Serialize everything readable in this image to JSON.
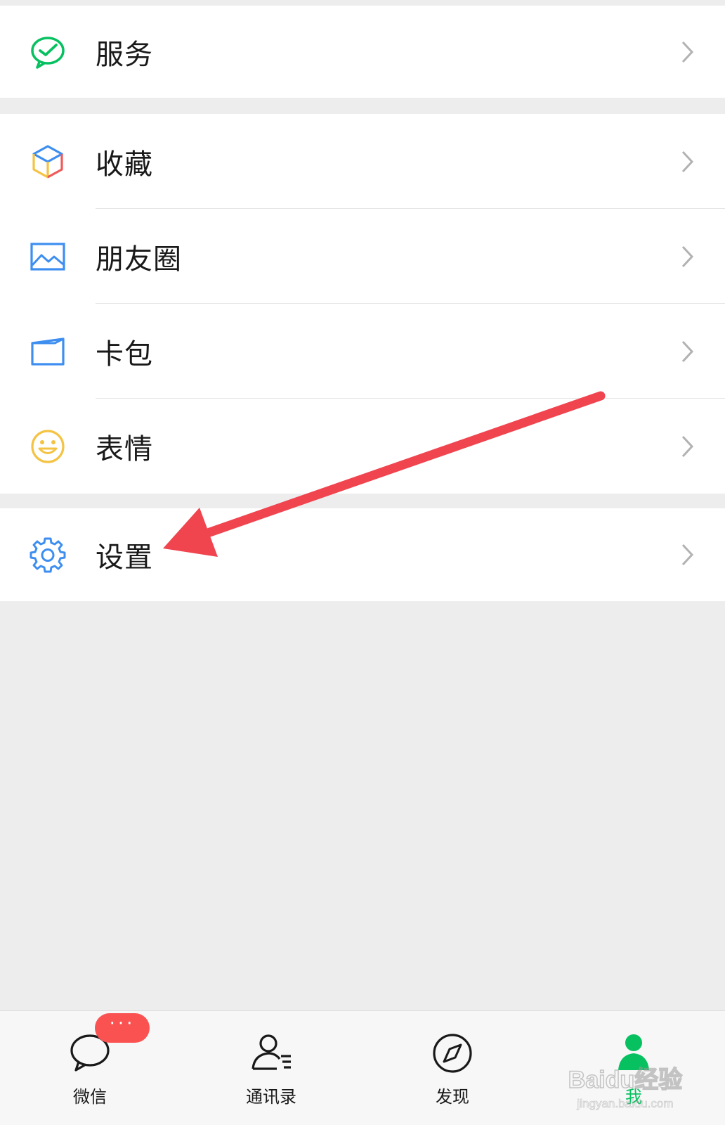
{
  "menu": {
    "service": {
      "label": "服务",
      "icon": "wechat-pay-icon"
    },
    "favorites": {
      "label": "收藏",
      "icon": "cube-icon"
    },
    "moments": {
      "label": "朋友圈",
      "icon": "picture-icon"
    },
    "cards": {
      "label": "卡包",
      "icon": "card-icon"
    },
    "stickers": {
      "label": "表情",
      "icon": "smile-icon"
    },
    "settings": {
      "label": "设置",
      "icon": "gear-icon"
    }
  },
  "tabbar": {
    "chats": {
      "label": "微信",
      "icon": "chat-bubble-icon"
    },
    "contacts": {
      "label": "通讯录",
      "icon": "contacts-icon"
    },
    "discover": {
      "label": "发现",
      "icon": "compass-icon"
    },
    "me": {
      "label": "我",
      "icon": "person-icon"
    }
  },
  "badge": {
    "text": "···"
  },
  "watermark": {
    "text": "Baidu经验",
    "subtext": "jingyan.baidu.com"
  },
  "colors": {
    "accent": "#07c160",
    "badge": "#fa5151",
    "annotation_arrow": "#f0444f",
    "background": "#ededed"
  }
}
